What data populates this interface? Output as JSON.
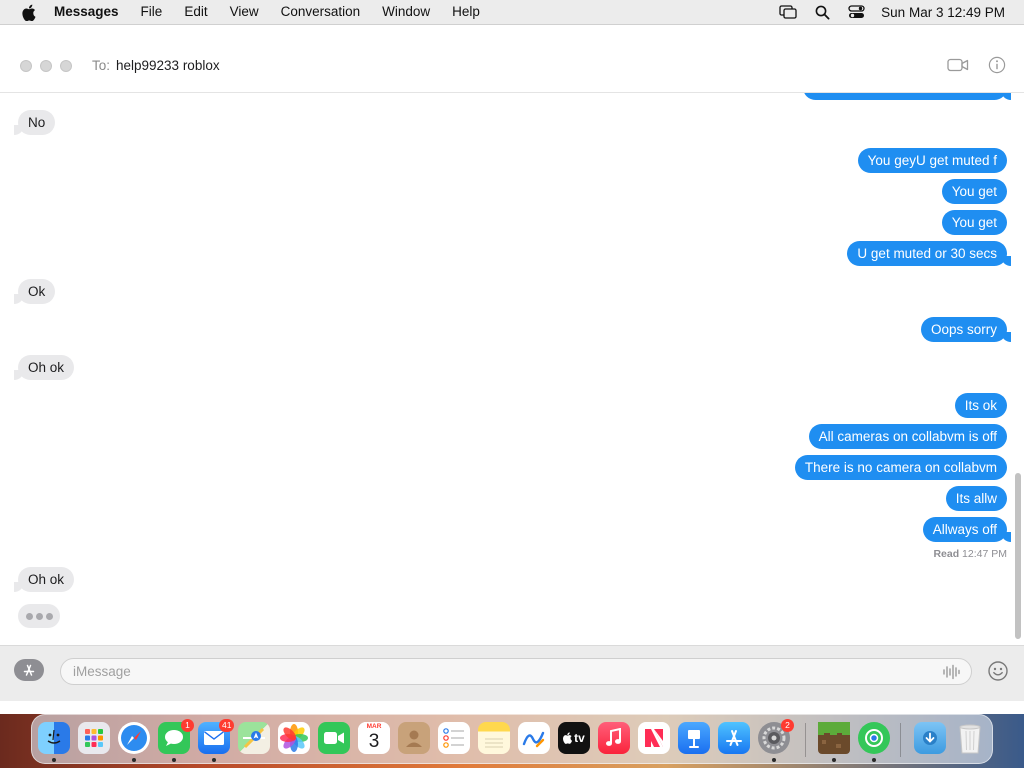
{
  "menubar": {
    "app_name": "Messages",
    "items": [
      "File",
      "Edit",
      "View",
      "Conversation",
      "Window",
      "Help"
    ],
    "clock": "Sun Mar 3  12:49 PM",
    "status_icons": [
      "screen-mirroring-icon",
      "search-icon",
      "control-center-icon"
    ]
  },
  "conversation": {
    "to_label": "To:",
    "recipient": "help99233 roblox",
    "messages": [
      {
        "from": "them",
        "text": "No"
      },
      {
        "from": "me",
        "text": "You geyU get muted f"
      },
      {
        "from": "me",
        "text": "You get"
      },
      {
        "from": "me",
        "text": "You get"
      },
      {
        "from": "me",
        "text": "U get muted or 30 secs"
      },
      {
        "from": "them",
        "text": "Ok"
      },
      {
        "from": "me",
        "text": "Oops sorry"
      },
      {
        "from": "them",
        "text": "Oh ok"
      },
      {
        "from": "me",
        "text": "Its ok"
      },
      {
        "from": "me",
        "text": "All cameras on collabvm is off"
      },
      {
        "from": "me",
        "text": "There is no camera on collabvm"
      },
      {
        "from": "me",
        "text": "Its allw"
      },
      {
        "from": "me",
        "text": "Allways off"
      },
      {
        "from": "them",
        "text": "Oh ok"
      }
    ],
    "read_receipt": {
      "label": "Read",
      "time": "12:47 PM"
    },
    "typing_indicator": true
  },
  "compose": {
    "placeholder": "iMessage",
    "value": ""
  },
  "colors": {
    "outgoing_bubble": "#1f8ef1",
    "incoming_bubble": "#e9e9eb",
    "badge": "#ff3b30"
  },
  "dock": {
    "apps": [
      {
        "name": "Finder",
        "icon": "finder-icon",
        "running": true
      },
      {
        "name": "Launchpad",
        "icon": "launchpad-icon",
        "running": false
      },
      {
        "name": "Safari",
        "icon": "safari-icon",
        "running": true
      },
      {
        "name": "Messages",
        "icon": "messages-icon",
        "running": true,
        "badge": "1"
      },
      {
        "name": "Mail",
        "icon": "mail-icon",
        "running": true,
        "badge": "41"
      },
      {
        "name": "Maps",
        "icon": "maps-icon",
        "running": false
      },
      {
        "name": "Photos",
        "icon": "photos-icon",
        "running": false
      },
      {
        "name": "FaceTime",
        "icon": "facetime-icon",
        "running": false
      },
      {
        "name": "Calendar",
        "icon": "calendar-icon",
        "running": false,
        "month": "MAR",
        "day": "3"
      },
      {
        "name": "Contacts",
        "icon": "contacts-icon",
        "running": false
      },
      {
        "name": "Reminders",
        "icon": "reminders-icon",
        "running": false
      },
      {
        "name": "Notes",
        "icon": "notes-icon",
        "running": false
      },
      {
        "name": "Freeform",
        "icon": "freeform-icon",
        "running": false
      },
      {
        "name": "TV",
        "icon": "tv-icon",
        "running": false,
        "label": "tv"
      },
      {
        "name": "Music",
        "icon": "music-icon",
        "running": false
      },
      {
        "name": "News",
        "icon": "news-icon",
        "running": false
      },
      {
        "name": "Keynote",
        "icon": "keynote-icon",
        "running": false
      },
      {
        "name": "App Store",
        "icon": "app-store-icon",
        "running": false
      },
      {
        "name": "System Settings",
        "icon": "system-settings-icon",
        "running": true,
        "badge": "2"
      },
      {
        "name": "Minecraft",
        "icon": "minecraft-icon",
        "running": true
      },
      {
        "name": "Find My",
        "icon": "find-my-icon",
        "running": true
      },
      {
        "name": "Downloads",
        "icon": "downloads-folder-icon",
        "running": false
      },
      {
        "name": "Trash",
        "icon": "trash-icon",
        "running": false
      }
    ]
  }
}
